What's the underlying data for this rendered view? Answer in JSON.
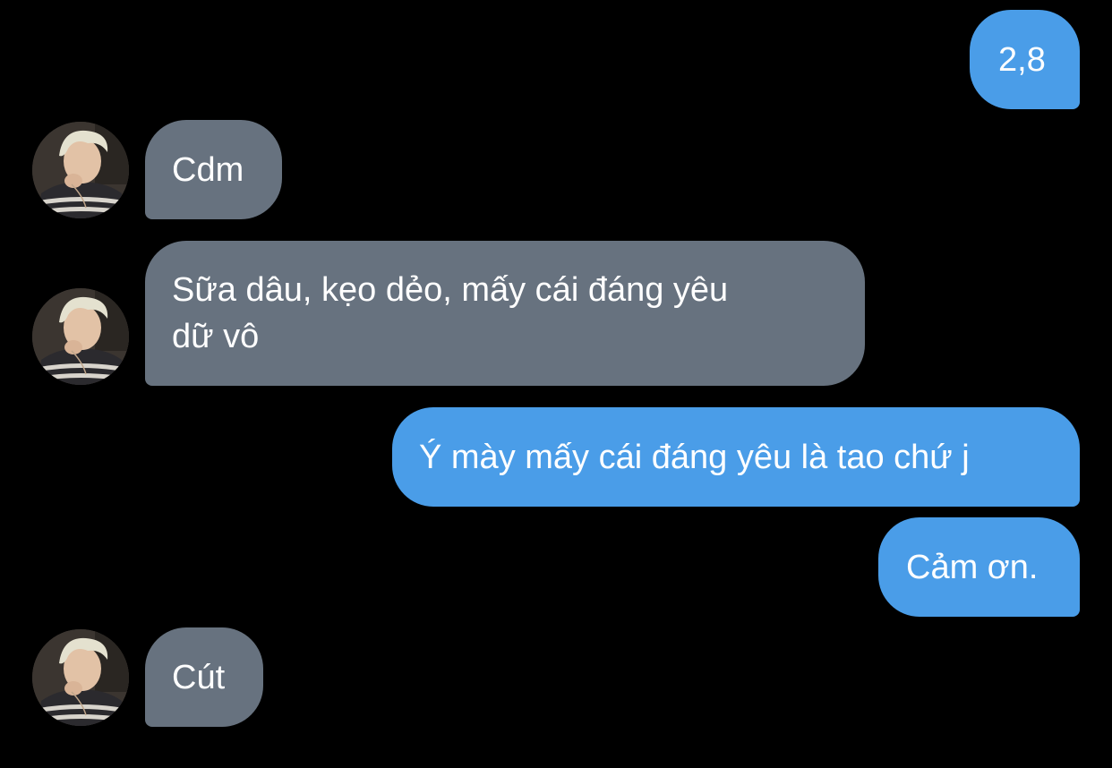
{
  "colors": {
    "background": "#000000",
    "outgoing_bubble": "#4a9de8",
    "incoming_bubble": "#67727f",
    "text": "#ffffff"
  },
  "messages": [
    {
      "direction": "outgoing",
      "text": "2,8"
    },
    {
      "direction": "incoming",
      "text": "Cdm",
      "avatar": "user-avatar"
    },
    {
      "direction": "incoming",
      "lines": [
        "Sữa dâu, kẹo dẻo, mấy cái đáng yêu",
        "dữ vô"
      ],
      "avatar": "user-avatar"
    },
    {
      "direction": "outgoing",
      "text": "Ý mày mấy cái đáng yêu là tao chứ j"
    },
    {
      "direction": "outgoing",
      "text": "Cảm ơn."
    },
    {
      "direction": "incoming",
      "text": "Cút",
      "avatar": "user-avatar"
    }
  ]
}
